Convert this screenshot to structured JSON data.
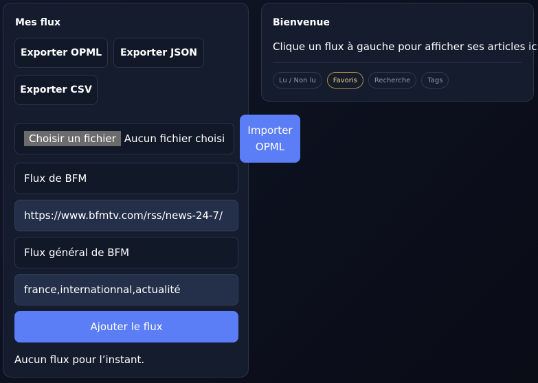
{
  "sidebar": {
    "title": "Mes flux",
    "export_buttons": [
      "Exporter OPML",
      "Exporter JSON",
      "Exporter CSV"
    ],
    "file_input": {
      "button_label": "Choisir un fichier",
      "status": "Aucun fichier choisi"
    },
    "fields": {
      "name": "Flux de BFM",
      "url": "https://www.bfmtv.com/rss/news-24-7/",
      "description": "Flux général de BFM",
      "tags": "france,internationnal,actualité"
    },
    "add_button": "Ajouter le flux",
    "empty_message": "Aucun flux pour l’instant."
  },
  "import": {
    "line1": "Importer",
    "line2": "OPML"
  },
  "welcome": {
    "title": "Bienvenue",
    "text": "Clique un flux à gauche pour afficher ses articles ici.",
    "filters": [
      "Lu / Non lu",
      "Favoris",
      "Recherche",
      "Tags"
    ],
    "active_filter": "Favoris"
  },
  "colors": {
    "accent": "#5b7df6",
    "active_filter": "#f2d47a",
    "card_bg": "#151c2e"
  }
}
